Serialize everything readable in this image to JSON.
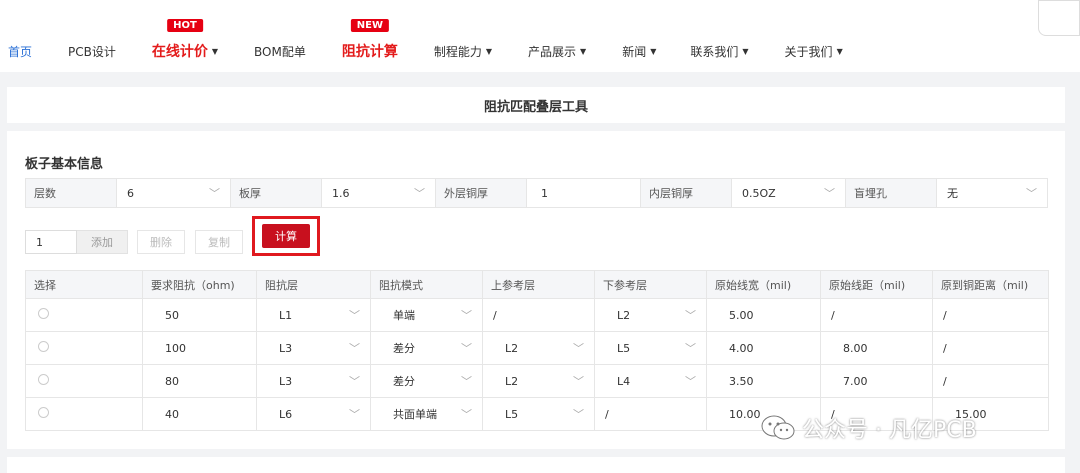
{
  "nav": {
    "items": [
      {
        "label": "首页",
        "active": true
      },
      {
        "label": "PCB设计"
      },
      {
        "label": "在线计价",
        "dropdown": true,
        "hot": true,
        "badge": "HOT"
      },
      {
        "label": "BOM配单"
      },
      {
        "label": "阻抗计算",
        "hot": true,
        "badge": "NEW"
      },
      {
        "label": "制程能力",
        "dropdown": true
      },
      {
        "label": "产品展示",
        "dropdown": true
      },
      {
        "label": "新闻",
        "dropdown": true
      },
      {
        "label": "联系我们",
        "dropdown": true
      },
      {
        "label": "关于我们",
        "dropdown": true
      }
    ]
  },
  "page_title": "阻抗匹配叠层工具",
  "section_title": "板子基本信息",
  "info": [
    {
      "label": "层数",
      "value": "6"
    },
    {
      "label": "板厚",
      "value": "1.6"
    },
    {
      "label": "外层铜厚",
      "value": "1"
    },
    {
      "label": "内层铜厚",
      "value": "0.5OZ"
    },
    {
      "label": "盲埋孔",
      "value": "无"
    }
  ],
  "actions": {
    "qty": "1",
    "add": "添加",
    "delete": "删除",
    "copy": "复制",
    "calc": "计算"
  },
  "table": {
    "headers": [
      "选择",
      "要求阻抗（ohm)",
      "阻抗层",
      "阻抗模式",
      "上参考层",
      "下参考层",
      "原始线宽（mil)",
      "原始线距（mil)",
      "原到铜距离（mil)"
    ],
    "rows": [
      [
        "",
        "50",
        "L1",
        "单端",
        "/",
        "L2",
        "5.00",
        "/",
        "/"
      ],
      [
        "",
        "100",
        "L3",
        "差分",
        "L2",
        "L5",
        "4.00",
        "8.00",
        "/"
      ],
      [
        "",
        "80",
        "L3",
        "差分",
        "L2",
        "L4",
        "3.50",
        "7.00",
        "/"
      ],
      [
        "",
        "40",
        "L6",
        "共面单端",
        "L5",
        "/",
        "10.00",
        "/",
        "15.00"
      ]
    ]
  },
  "watermark": "公众号 · 凡亿PCB",
  "colors": {
    "accent": "#c8101e",
    "link": "#2a6fd6",
    "badge": "#e60012"
  }
}
